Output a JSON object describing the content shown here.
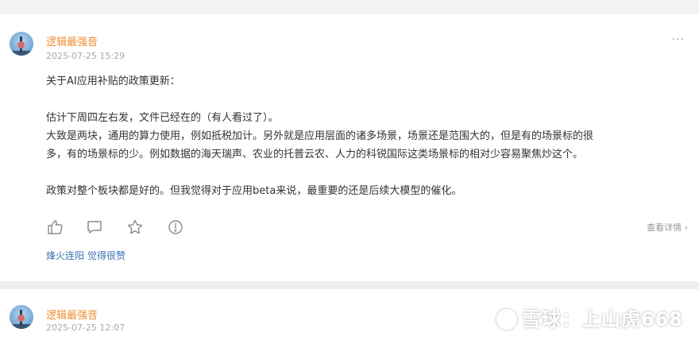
{
  "post1": {
    "username": "逻辑最强音",
    "time": "2025-07-25 15:29",
    "more": "···",
    "paragraphs": [
      "关于AI应用补贴的政策更新：",
      "",
      "估计下周四左右发，文件已经在的（有人看过了）。",
      "大致是两块，通用的算力使用，例如抵税加计。另外就是应用层面的诸多场景，场景还是范围大的，但是有的场景标的很",
      "多，有的场景标的少。例如数据的海天瑞声、农业的托普云农、人力的科锐国际这类场景标的相对少容易聚焦炒这个。",
      "",
      "政策对整个板块都是好的。但我觉得对于应用beta来说，最重要的还是后续大模型的催化。"
    ],
    "detail_link": "查看详情 ›",
    "liker": "烽火连阳",
    "liked_text": "觉得很赞"
  },
  "post2": {
    "username": "逻辑最强音",
    "time": "2025-07-25 12:07"
  },
  "watermark": "雪球：上山虎668",
  "colors": {
    "username": "#f08c30",
    "link": "#3a6fb4",
    "muted": "#a9a9a9"
  }
}
